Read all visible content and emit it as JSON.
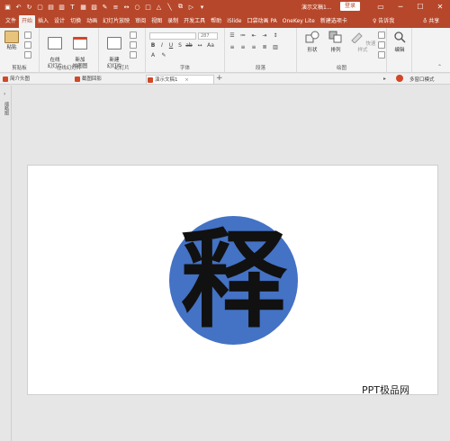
{
  "titlebar": {
    "doc_title": "演示文稿1...",
    "login_label": "登录",
    "minimize": "─",
    "restore": "☐",
    "close": "✕"
  },
  "ribbon_tabs": [
    "文件",
    "开始",
    "插入",
    "设计",
    "切换",
    "动画",
    "幻灯片放映",
    "审阅",
    "视图",
    "录制",
    "开发工具",
    "帮助",
    "iSlide",
    "口袋动画 PA",
    "OneKey Lite",
    "新建选项卡"
  ],
  "tell_me": "♀ 告诉我",
  "share": "♁ 共享",
  "groups": {
    "clipboard": {
      "label": "剪贴板",
      "paste": "粘贴"
    },
    "online_slides": {
      "label": "在线幻灯片",
      "online": "在线\n幻灯片",
      "new_online": "新加\n拍图图"
    },
    "slides": {
      "label": "幻灯片",
      "new_slide": "新建\n幻灯片"
    },
    "font": {
      "label": "字体",
      "font_size": "287"
    },
    "paragraph": {
      "label": "段落"
    },
    "drawing": {
      "label": "绘图",
      "shapes": "形状",
      "arrange": "排列",
      "quick_styles": "快速样式"
    },
    "editing": {
      "label": "编辑",
      "edit": "编辑"
    }
  },
  "doc_tabs": [
    {
      "label": "简介头图"
    },
    {
      "label": "截图回影"
    },
    {
      "label": "演示文稿1"
    }
  ],
  "multi_window": "多窗口模式",
  "left_strip_label": "缩略图",
  "slide": {
    "glyph": "释"
  },
  "watermark": "PPT极品网",
  "colors": {
    "accent": "#b7472a",
    "circle": "#4472c4"
  }
}
